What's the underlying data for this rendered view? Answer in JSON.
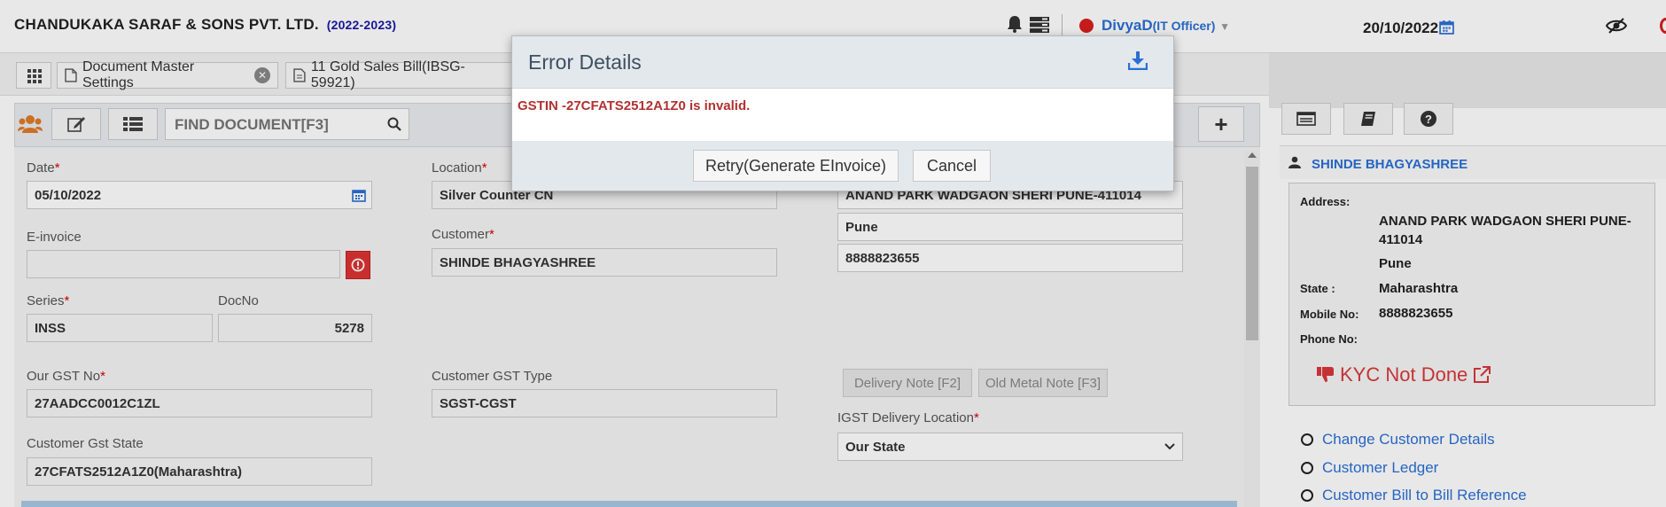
{
  "header": {
    "company": "CHANDUKAKA SARAF & SONS PVT. LTD.",
    "year": "(2022-2023)",
    "user": "DivyaD",
    "role": "(IT Officer)",
    "date": "20/10/2022"
  },
  "tabs": [
    {
      "label": "Document Master Settings"
    },
    {
      "label": "11 Gold Sales Bill(IBSG-59921)"
    }
  ],
  "toolbar": {
    "find_placeholder": "FIND DOCUMENT[F3]"
  },
  "form": {
    "date_label": "Date",
    "date_value": "05/10/2022",
    "einvoice_label": "E-invoice",
    "einvoice_value": "",
    "series_label": "Series",
    "series_value": "INSS",
    "docno_label": "DocNo",
    "docno_value": "5278",
    "gst_label": "Our GST No",
    "gst_value": "27AADCC0012C1ZL",
    "cust_gst_state_label": "Customer Gst State",
    "cust_gst_state_value": "27CFATS2512A1Z0(Maharashtra)",
    "location_label": "Location",
    "location_value": "Silver Counter CN",
    "customer_label": "Customer",
    "customer_value": "SHINDE BHAGYASHREE",
    "cust_gst_type_label": "Customer GST Type",
    "cust_gst_type_value": "SGST-CGST",
    "address_value": "ANAND PARK WADGAON SHERI PUNE-411014",
    "city_value": "Pune",
    "phone_value": "8888823655",
    "delivery_note_btn": "Delivery Note [F2]",
    "old_metal_btn": "Old Metal Note [F3]",
    "igst_label": "IGST Delivery Location",
    "igst_value": "Our State"
  },
  "right_panel": {
    "name": "SHINDE BHAGYASHREE",
    "address_label": "Address:",
    "address_line1": "ANAND PARK WADGAON SHERI PUNE-",
    "address_line2": "411014",
    "city": "Pune",
    "state_label": "State :",
    "state_value": "Maharashtra",
    "mobile_label": "Mobile No:",
    "mobile_value": "8888823655",
    "phone_label": "Phone No:",
    "phone_value": "",
    "kyc": "KYC Not Done",
    "links": [
      {
        "label": "Change Customer Details"
      },
      {
        "label": "Customer Ledger"
      },
      {
        "label": "Customer Bill to Bill Reference"
      }
    ]
  },
  "modal": {
    "title": "Error Details",
    "message": "GSTIN -27CFATS2512A1Z0 is invalid.",
    "retry_label": "Retry(Generate EInvoice)",
    "cancel_label": "Cancel"
  },
  "colors": {
    "accent": "#2a6fd6",
    "error": "#b23030",
    "status_dot": "#d81e1e"
  }
}
